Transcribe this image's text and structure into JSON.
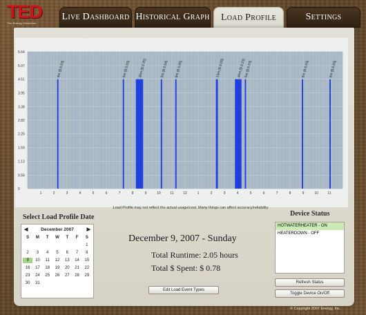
{
  "logo": {
    "text": "TED",
    "tagline": "The Energy Detective"
  },
  "tabs": [
    {
      "label": "Live Dashboard",
      "active": false
    },
    {
      "label": "Historical Graph",
      "active": false
    },
    {
      "label": "Load Profile",
      "active": true
    },
    {
      "label": "Settings",
      "active": false
    }
  ],
  "chart_data": {
    "type": "bar",
    "y_ticks": [
      "5.64",
      "5.07",
      "4.51",
      "3.95",
      "3.38",
      "2.82",
      "2.26",
      "1.69",
      "1.13",
      "0.56",
      "0"
    ],
    "ylim": [
      0,
      5.64
    ],
    "x_ticks": [
      "1",
      "2",
      "3",
      "4",
      "5",
      "6",
      "7",
      "8",
      "9",
      "10",
      "11",
      "12",
      "1",
      "2",
      "3",
      "4",
      "5",
      "6",
      "7",
      "8",
      "9",
      "10",
      "11"
    ],
    "x_range": [
      0,
      24
    ],
    "bars": [
      {
        "x": 2.25,
        "width": 0.1,
        "value": 4.51,
        "label": "4m ($ 0.03)"
      },
      {
        "x": 7.25,
        "width": 0.1,
        "value": 4.51,
        "label": "5m ($ 0.03)"
      },
      {
        "x": 8.25,
        "width": 0.55,
        "value": 4.51,
        "label": "30m ($ 0.25)"
      },
      {
        "x": 10.15,
        "width": 0.1,
        "value": 4.51,
        "label": "5m ($ 0.04)"
      },
      {
        "x": 11.25,
        "width": 0.1,
        "value": 4.51,
        "label": "6m ($ 0.05)"
      },
      {
        "x": 14.35,
        "width": 0.15,
        "value": 4.51,
        "label": "13m ($ 0.09)"
      },
      {
        "x": 15.8,
        "width": 0.5,
        "value": 4.51,
        "label": "30m ($ 0.23)"
      },
      {
        "x": 16.55,
        "width": 0.1,
        "value": 4.51,
        "label": "5m ($ 0.03)"
      },
      {
        "x": 20.9,
        "width": 0.1,
        "value": 4.51,
        "label": "6m ($ 0.03)"
      },
      {
        "x": 23.0,
        "width": 0.1,
        "value": 4.51,
        "label": "6m ($ 0.03)"
      }
    ],
    "grid": true,
    "bar_color": "#1f3fe0",
    "plot_bg": "#a9b8c4"
  },
  "disclaimer": "Load Profile may not reflect the actual usage/cost.  Many things can affect accuracy/reliability",
  "date_section": {
    "title": "Select Load Profile Date",
    "month_label": "December 2007",
    "prev_arrow": "◀",
    "next_arrow": "▶",
    "days_of_week": [
      "S",
      "M",
      "T",
      "W",
      "T",
      "F",
      "S"
    ],
    "weeks": [
      [
        "",
        "",
        "",
        "",
        "",
        "",
        "1"
      ],
      [
        "2",
        "3",
        "4",
        "5",
        "6",
        "7",
        "8"
      ],
      [
        "9",
        "10",
        "11",
        "12",
        "13",
        "14",
        "15"
      ],
      [
        "16",
        "17",
        "18",
        "19",
        "20",
        "21",
        "22"
      ],
      [
        "23",
        "24",
        "25",
        "26",
        "27",
        "28",
        "29"
      ],
      [
        "30",
        "31",
        "",
        "",
        "",
        "",
        ""
      ]
    ],
    "selected_day": "9"
  },
  "summary": {
    "date": "December 9, 2007 - Sunday",
    "runtime": "Total Runtime: 2.05 hours",
    "spent": "Total $ Spent:  $ 0.78",
    "edit_button": "Edit Load Event Types"
  },
  "device_status": {
    "title": "Device Status",
    "devices": [
      {
        "label": "HOTWATERHEATER - ON",
        "on": true
      },
      {
        "label": "HEATERDOWN - OFF",
        "on": false
      }
    ],
    "refresh_button": "Refresh Status",
    "toggle_button": "Toggle Device On/Off"
  },
  "footer": "© Copyright 2007  Energy, Inc."
}
